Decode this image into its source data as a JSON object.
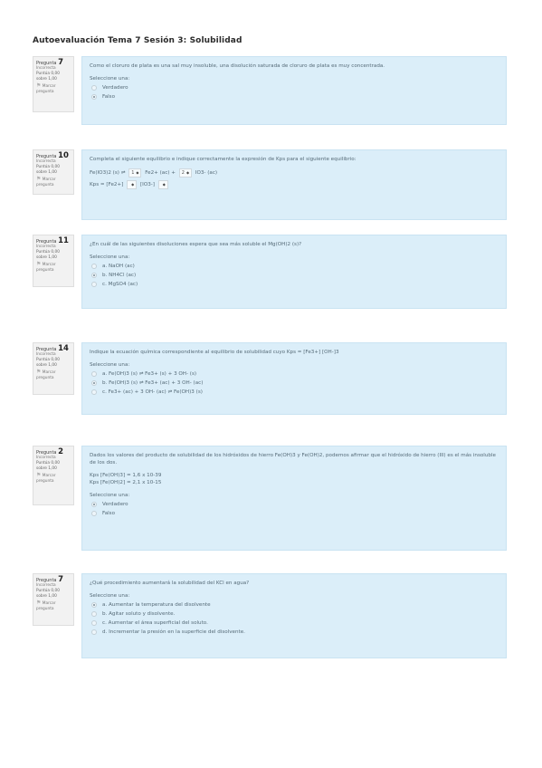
{
  "page_title": "Autoevaluación Tema 7 Sesión 3: Solubilidad",
  "flag_label": "Marcar pregunta",
  "questions": [
    {
      "number_label": "Pregunta",
      "number": "7",
      "state": "Incorrecta",
      "score": "Puntúa 0,00 sobre 1,00",
      "text": "Como el cloruro de plata es una sal muy insoluble, una disolución saturada de cloruro de plata es muy concentrada.",
      "prompt": "Seleccione una:",
      "options": [
        "Verdadero",
        "Falso"
      ],
      "checked": 1
    },
    {
      "number_label": "Pregunta",
      "number": "10",
      "state": "Incorrecta",
      "score": "Puntúa 0,00 sobre 1,00",
      "text": "Completa el siguiente equilibrio e indique correctamente la expresión de Kps para el siguiente equilibrio:",
      "eq": {
        "left": "Fe(IO3)2 (s) ⇌",
        "sel1": "1",
        "mid": "Fe2+ (ac) +",
        "sel2": "2",
        "right": "IO3- (ac)"
      },
      "kps": {
        "prefix": "Kps = [Fe2+]",
        "sel1": "",
        "mid": "[IO3-]",
        "sel2": ""
      }
    },
    {
      "number_label": "Pregunta",
      "number": "11",
      "state": "Incorrecta",
      "score": "Puntúa 0,00 sobre 1,00",
      "text": "¿En cuál de las siguientes disoluciones espera que sea más soluble el Mg(OH)2 (s)?",
      "prompt": "Seleccione una:",
      "options": [
        "a. NaOH (ac)",
        "b. NH4Cl (ac)",
        "c. MgSO4 (ac)"
      ],
      "checked": 1
    },
    {
      "number_label": "Pregunta",
      "number": "14",
      "state": "Incorrecta",
      "score": "Puntúa 0,00 sobre 1,00",
      "text": "Indique la ecuación química correspondiente al equilibrio de solubilidad cuyo Kps = [Fe3+] [OH-]3",
      "prompt": "Seleccione una:",
      "options": [
        "a. Fe(OH)3 (s) ⇌ Fe3+ (s) + 3 OH- (s)",
        "b. Fe(OH)3 (s) ⇌ Fe3+ (ac) + 3 OH- (ac)",
        "c. Fe3+ (ac) + 3 OH- (ac) ⇌ Fe(OH)3 (s)"
      ],
      "checked": 1
    },
    {
      "number_label": "Pregunta",
      "number": "2",
      "state": "Incorrecta",
      "score": "Puntúa 0,00 sobre 1,00",
      "text": "Dados los valores del producto de solubilidad de los hidróxidos de hierro Fe(OH)3 y Fe(OH)2, podemos afirmar que el hidróxido de hierro (III) es el más insoluble de los dos.",
      "kps_lines": [
        "Kps [Fe(OH)3] = 1,6 x 10-39",
        "Kps [Fe(OH)2] = 2,1 x 10-15"
      ],
      "prompt": "Seleccione una:",
      "options": [
        "Verdadero",
        "Falso"
      ],
      "checked": 0
    },
    {
      "number_label": "Pregunta",
      "number": "7",
      "state": "Incorrecta",
      "score": "Puntúa 0,00 sobre 1,00",
      "text": "¿Qué procedimiento aumentará la solubilidad del KCl en agua?",
      "prompt": "Seleccione una:",
      "options": [
        "a. Aumentar la temperatura del disolvente",
        "b. Agitar soluto y disolvente.",
        "c. Aumentar el área superficial del soluto.",
        "d. Incrementar la presión en la superficie del disolvente."
      ],
      "checked": 0
    }
  ]
}
